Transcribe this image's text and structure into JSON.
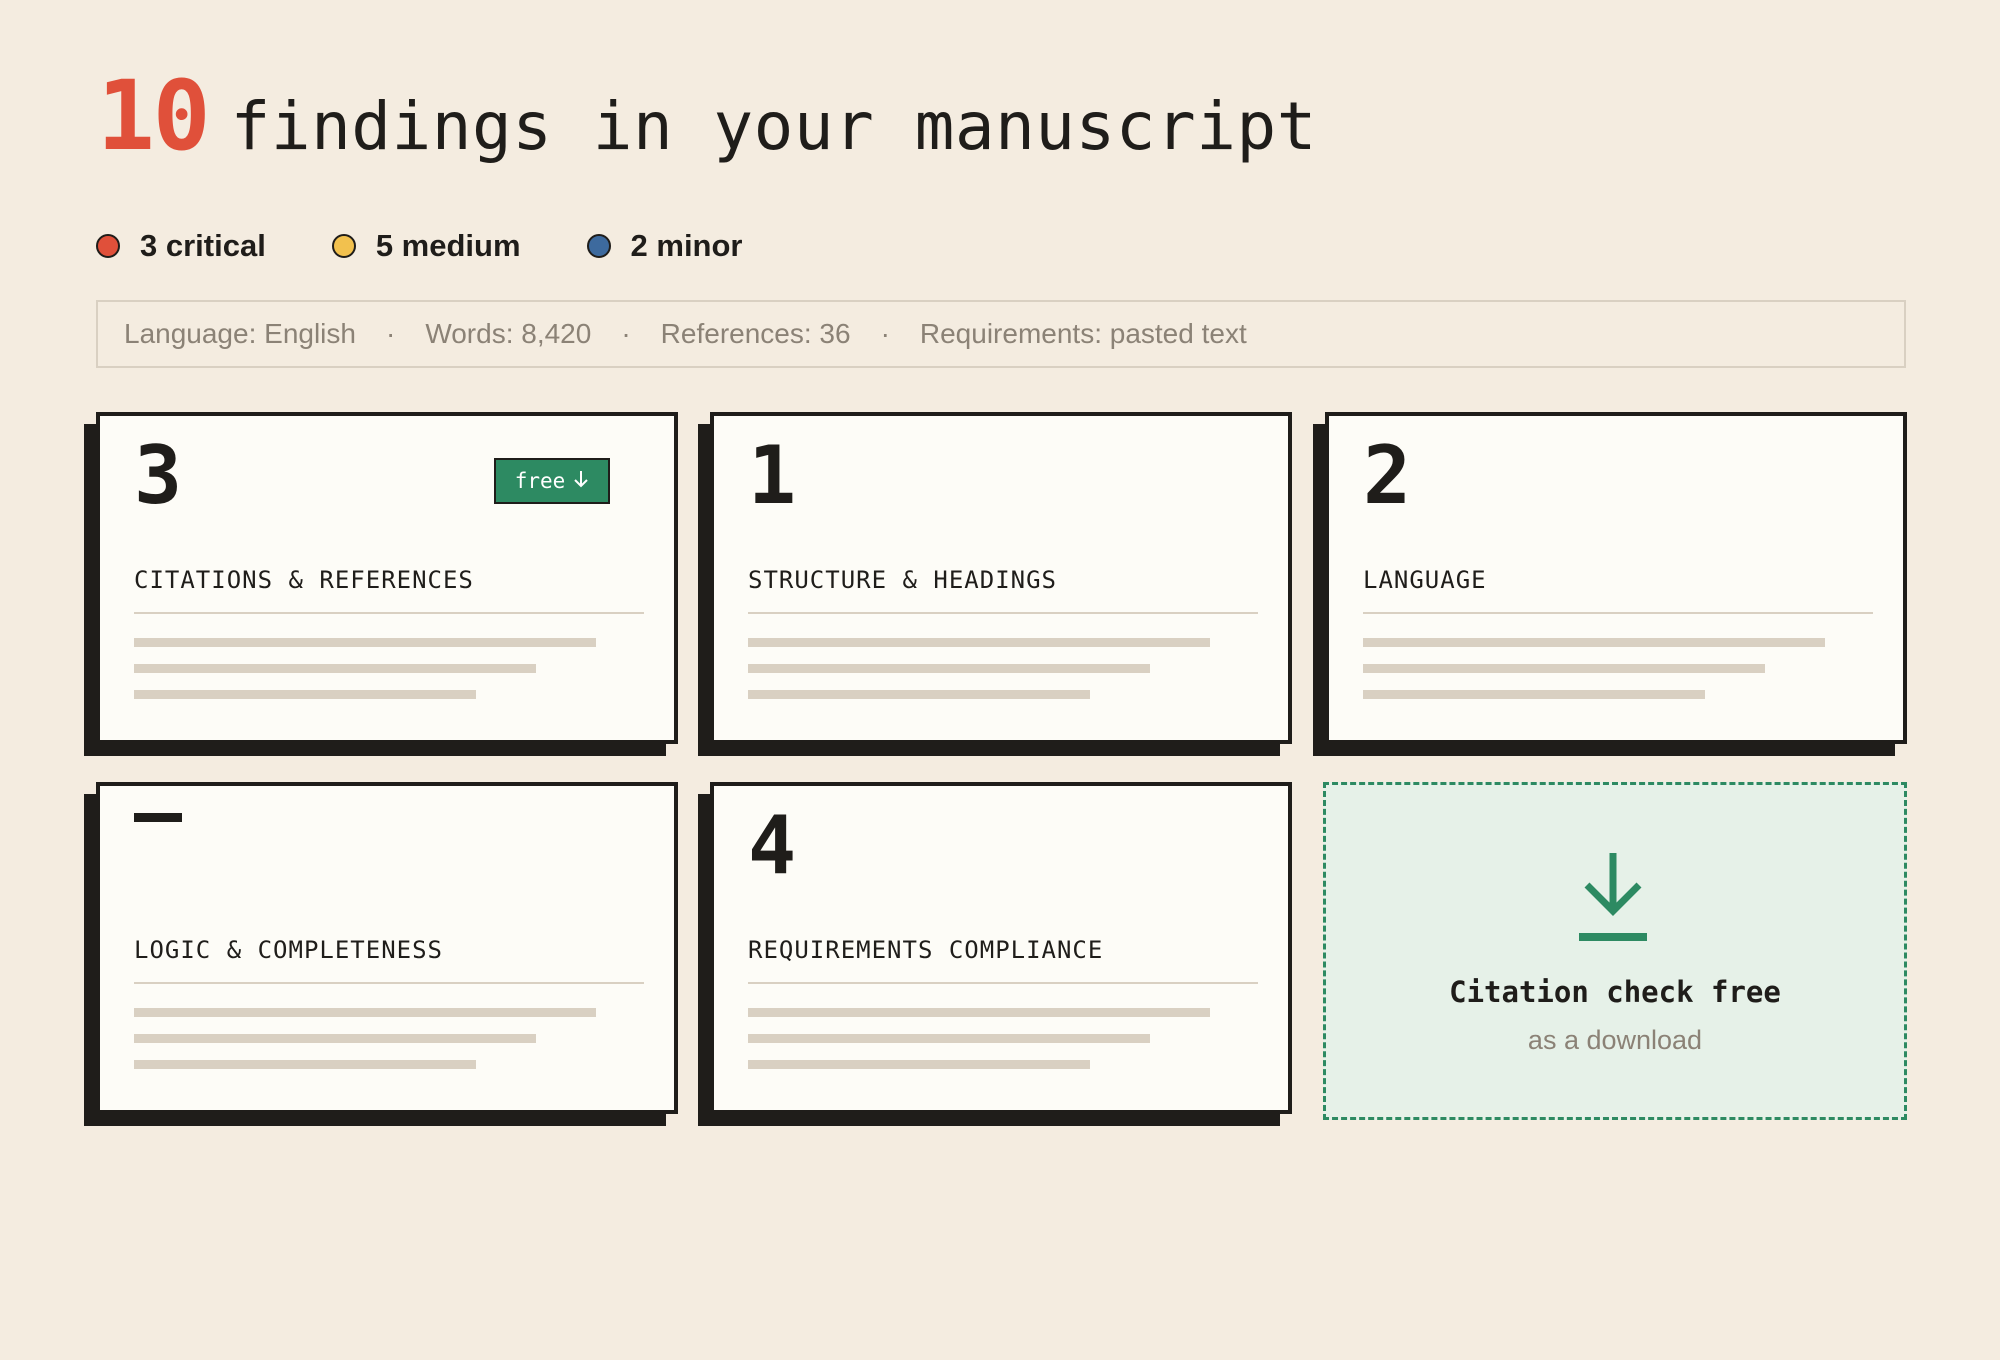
{
  "summary": {
    "count": "10",
    "heading": "findings in your manuscript"
  },
  "severity": [
    {
      "label": "3 critical",
      "color": "#e0503a"
    },
    {
      "label": "5 medium",
      "color": "#f2c14e"
    },
    {
      "label": "2 minor",
      "color": "#3d6a9e"
    }
  ],
  "meta": {
    "language": "Language: English",
    "words": "Words: 8,420",
    "references": "References: 36",
    "requirements": "Requirements: pasted text",
    "separator": "·"
  },
  "cards": [
    {
      "number": "3",
      "title": "CITATIONS & REFERENCES",
      "badge": "free",
      "badge_icon": "arrow-down-icon"
    },
    {
      "number": "1",
      "title": "STRUCTURE & HEADINGS"
    },
    {
      "number": "2",
      "title": "LANGUAGE"
    },
    {
      "number": "—",
      "title": "LOGIC & COMPLETENESS"
    },
    {
      "number": "4",
      "title": "REQUIREMENTS COMPLIANCE"
    }
  ],
  "download": {
    "title": "Citation check free",
    "subtitle": "as a download",
    "icon": "download-icon",
    "color": "#2d8a62"
  }
}
